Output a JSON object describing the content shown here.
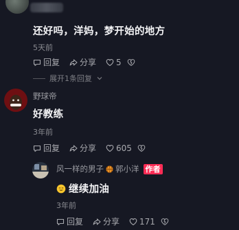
{
  "comment1": {
    "text": "还好吗，洋妈，梦开始的地方",
    "time": "5天前",
    "reply_label": "回复",
    "share_label": "分享",
    "like_count": "5",
    "expand_label": "展开1条回复"
  },
  "comment2": {
    "username": "野球帝",
    "text": "好教练",
    "time": "3年前",
    "reply_label": "回复",
    "share_label": "分享",
    "like_count": "605"
  },
  "reply": {
    "username_part1": "风一样的男子",
    "username_part2": "郭小洋",
    "author_tag": "作者",
    "text": "继续加油",
    "time": "3年前",
    "reply_label": "回复",
    "share_label": "分享",
    "like_count": "171"
  },
  "colors": {
    "background": "#161823",
    "author_tag": "#fe2c55",
    "secondary_text": "#8a8b91"
  }
}
